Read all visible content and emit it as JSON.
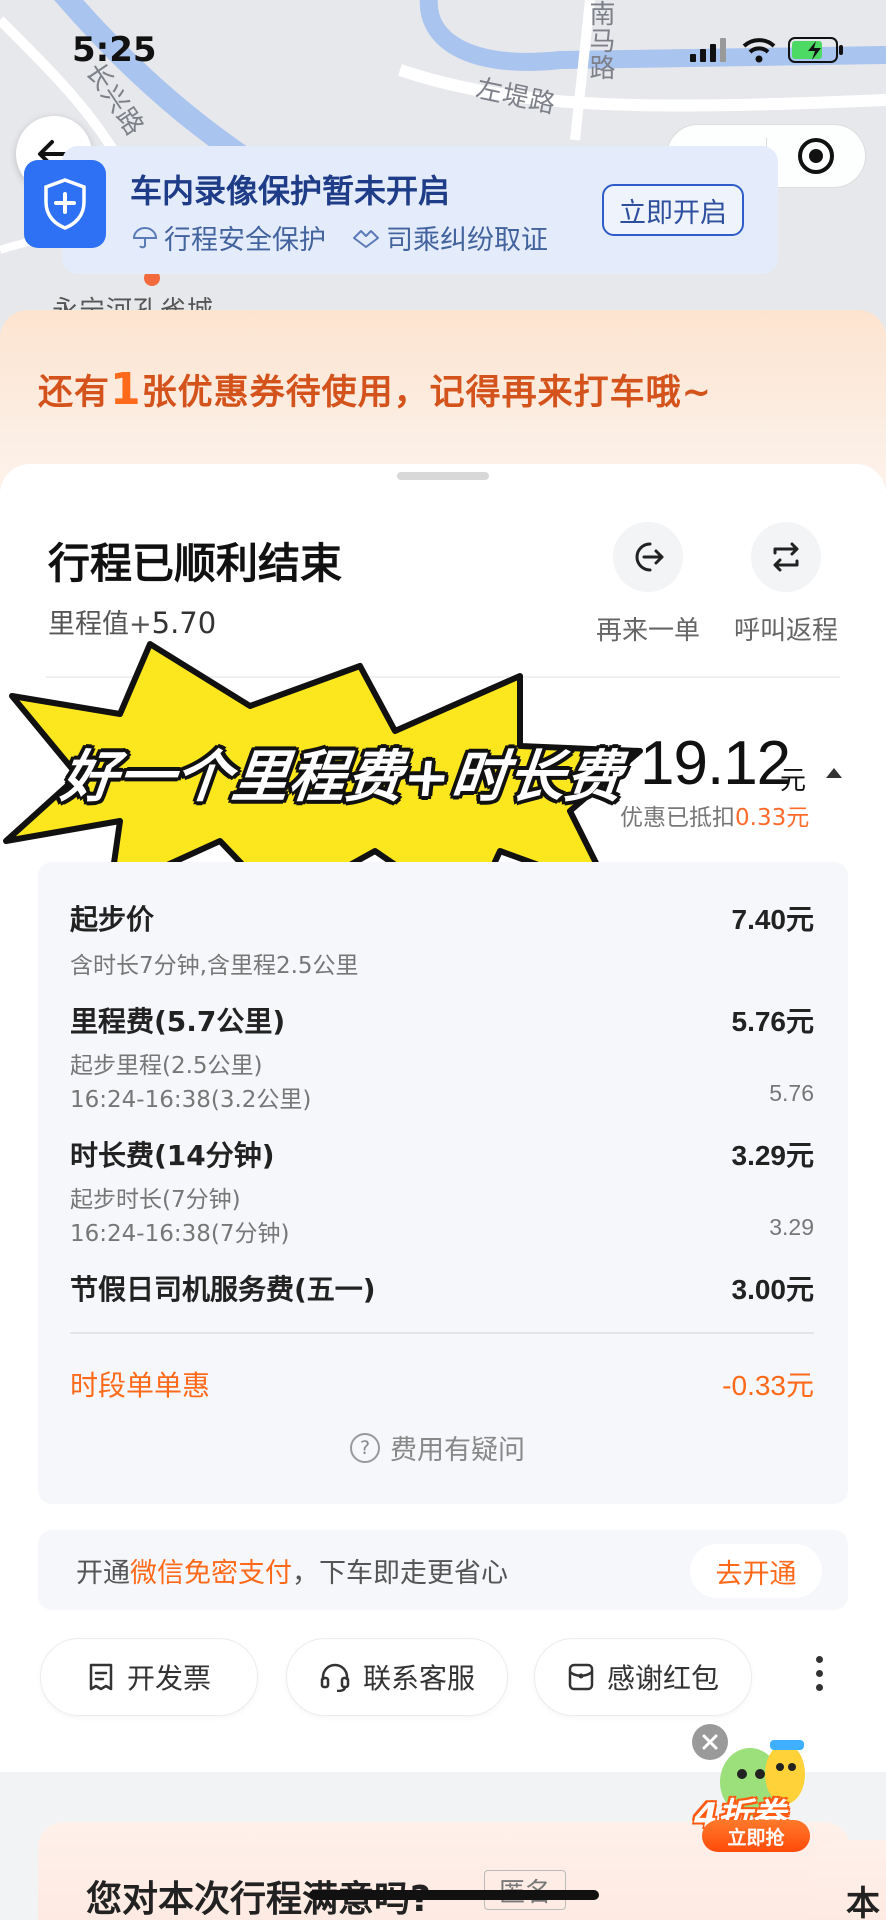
{
  "status_bar": {
    "time": "5:25"
  },
  "map": {
    "labels": {
      "road_a": "左堤路",
      "road_b": "南马路",
      "road_c": "长兴路",
      "place": "永宁河孔雀城"
    }
  },
  "video_protection": {
    "title": "车内录像保护暂未开启",
    "feature_1": "行程安全保护",
    "feature_2": "司乘纠纷取证",
    "button": "立即开启"
  },
  "coupon_banner": {
    "prefix": "还有",
    "count": "1",
    "suffix": "张优惠券待使用，记得再来打车哦~"
  },
  "trip": {
    "status_title": "行程已顺利结束",
    "mileage_label": "里程值+",
    "mileage_value": "5.70",
    "actions": [
      {
        "label": "再来一单",
        "icon": "reorder-icon"
      },
      {
        "label": "呼叫返程",
        "icon": "return-trip-icon"
      }
    ]
  },
  "sticker": {
    "text": "好一个里程费+时长费"
  },
  "price": {
    "total": "19.12",
    "unit": "元",
    "discount_prefix": "优惠已抵扣",
    "discount_value": "0.33元"
  },
  "fees": {
    "base": {
      "label": "起步价",
      "amount": "7.40元",
      "note": "含时长7分钟,含里程2.5公里"
    },
    "distance": {
      "label": "里程费(5.7公里)",
      "amount": "5.76元",
      "sub_1": "起步里程(2.5公里)",
      "sub_2": "16:24-16:38(3.2公里)",
      "sub_2_amount": "5.76"
    },
    "duration": {
      "label": "时长费(14分钟)",
      "amount": "3.29元",
      "sub_1": "起步时长(7分钟)",
      "sub_2": "16:24-16:38(7分钟)",
      "sub_2_amount": "3.29"
    },
    "holiday": {
      "label": "节假日司机服务费(五一)",
      "amount": "3.00元"
    },
    "promo": {
      "label": "时段单单惠",
      "amount": "-0.33元"
    },
    "question": "费用有疑问"
  },
  "payment": {
    "text_prefix": "开通",
    "text_highlight": "微信免密支付",
    "text_suffix": "，下车即走更省心",
    "button": "去开通"
  },
  "bottom_actions": [
    {
      "label": "开发票",
      "icon": "invoice-icon"
    },
    {
      "label": "联系客服",
      "icon": "headset-icon"
    },
    {
      "label": "感谢红包",
      "icon": "red-envelope-icon"
    }
  ],
  "promo_float": {
    "title": "4折券",
    "button": "立即抢"
  },
  "rating": {
    "question": "您对本次行程满意吗?",
    "anonymous": "匿名",
    "next_card_char": "本"
  },
  "colors": {
    "accent_orange": "#ff6a1a",
    "brand_blue": "#2f71f4",
    "sticker_yellow": "#fce71e"
  }
}
